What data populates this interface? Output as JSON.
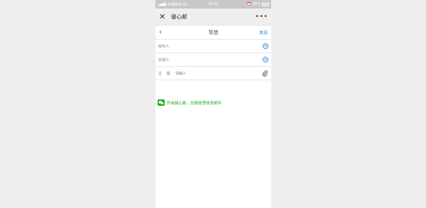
{
  "statusbar": {
    "carrier": "中国移动 4G",
    "time": "20:03",
    "battery": "45%"
  },
  "appbar": {
    "title": "骏心邮",
    "more": "•••",
    "close_icon": "close-icon"
  },
  "compose": {
    "title": "写信",
    "send": "发送",
    "to_label": "收件人:",
    "cc_label": "抄送人:",
    "subject_label": "主    题:",
    "subject_placeholder": "请输入"
  },
  "promo": {
    "text": "开启骏心邮，在微信里收发邮件"
  },
  "colors": {
    "accent_blue": "#1a8ae6",
    "wechat_green": "#1aad19",
    "statusbar": "#c8c8c8"
  }
}
